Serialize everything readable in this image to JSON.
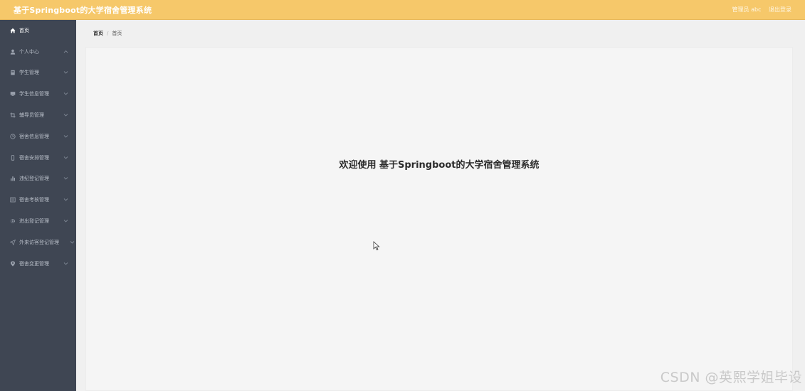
{
  "header": {
    "title": "基于Springboot的大学宿舍管理系统",
    "user_label": "管理员 abc",
    "logout_label": "退出登录"
  },
  "sidebar": {
    "items": [
      {
        "label": "首页",
        "icon": "home-icon",
        "has_arrow": false,
        "active": true
      },
      {
        "label": "个人中心",
        "icon": "user-icon",
        "has_arrow": true,
        "arrow": "up"
      },
      {
        "label": "学生管理",
        "icon": "document-icon",
        "has_arrow": true
      },
      {
        "label": "学生信息管理",
        "icon": "monitor-icon",
        "has_arrow": true
      },
      {
        "label": "辅导员管理",
        "icon": "crop-icon",
        "has_arrow": true
      },
      {
        "label": "宿舍信息管理",
        "icon": "clock-icon",
        "has_arrow": true
      },
      {
        "label": "宿舍安排管理",
        "icon": "phone-icon",
        "has_arrow": true
      },
      {
        "label": "违纪登记管理",
        "icon": "bar-chart-icon",
        "has_arrow": true
      },
      {
        "label": "宿舍考核管理",
        "icon": "list-icon",
        "has_arrow": true
      },
      {
        "label": "进出登记管理",
        "icon": "gear-icon",
        "has_arrow": true
      },
      {
        "label": "外来访客登记管理",
        "icon": "send-icon",
        "has_arrow": true
      },
      {
        "label": "宿舍变更管理",
        "icon": "location-icon",
        "has_arrow": true
      }
    ]
  },
  "breadcrumb": {
    "home": "首页",
    "separator": "/",
    "current": "首页"
  },
  "main": {
    "welcome": "欢迎使用 基于Springboot的大学宿舍管理系统"
  },
  "watermark": "CSDN @英熙学姐毕设",
  "colors": {
    "topbar": "#f6c86a",
    "sidebar": "#3f4653",
    "background": "#f0f0f0"
  }
}
